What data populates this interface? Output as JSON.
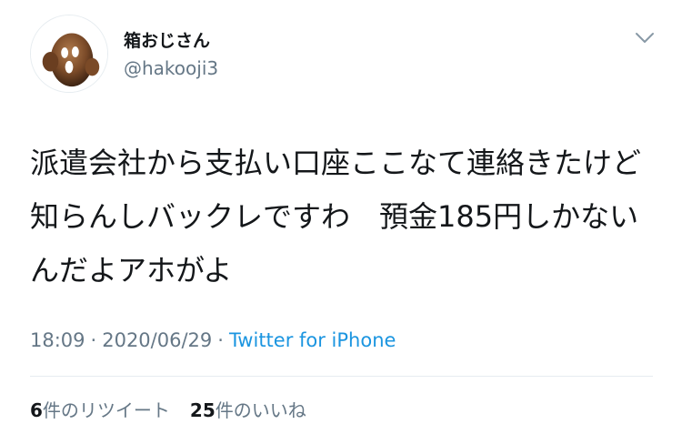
{
  "user": {
    "display_name": "箱おじさん",
    "handle": "@hakooji3"
  },
  "tweet": {
    "text": "派遣会社から支払い口座ここなて連絡きたけど知らんしバックレですわ　預金185円しかないんだよアホがよ",
    "time": "18:09",
    "date": "2020/06/29",
    "separator": "·",
    "source": "Twitter for iPhone"
  },
  "stats": {
    "retweets_count": "6",
    "retweets_label": "件のリツイート",
    "likes_count": "25",
    "likes_label": "件のいいね"
  },
  "icons": {
    "more": "chevron-down-icon"
  },
  "colors": {
    "text": "#14171a",
    "secondary": "#657786",
    "link": "#1b95e0",
    "divider": "#e6ecf0"
  }
}
